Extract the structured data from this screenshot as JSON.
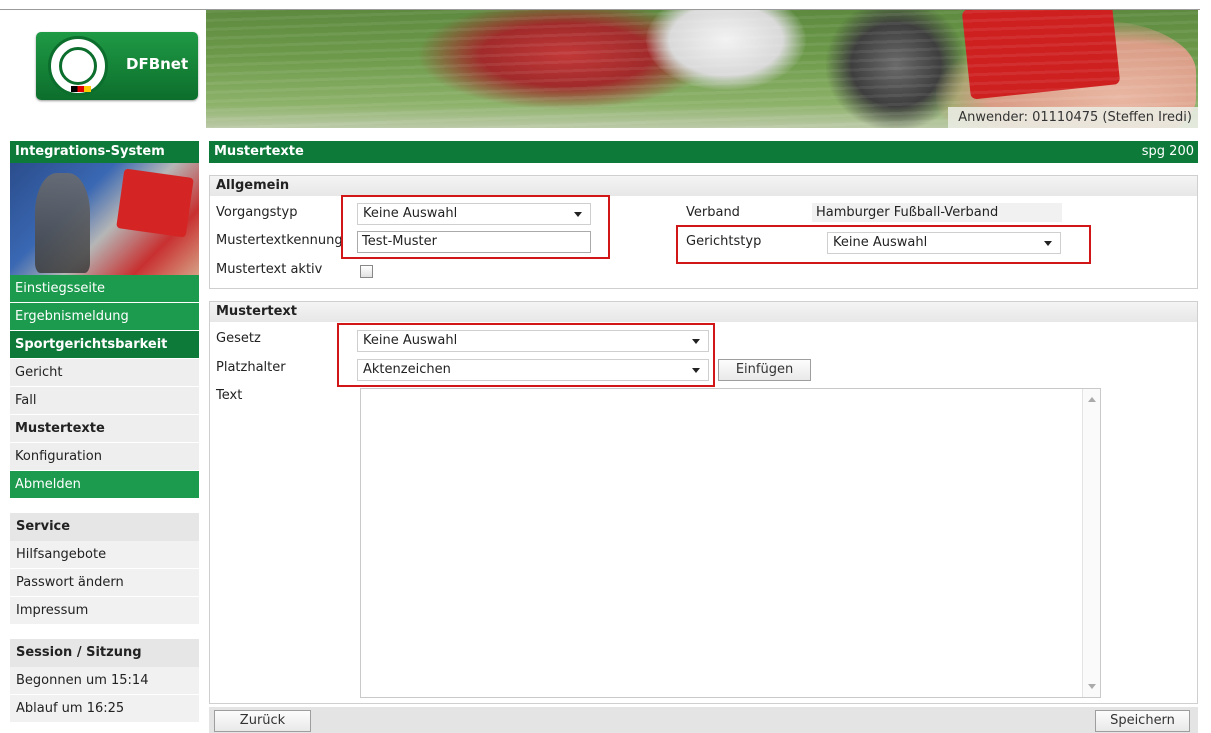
{
  "header": {
    "logo_text": "DFBnet",
    "user_info": "Anwender: 01110475 (Steffen Iredi)"
  },
  "sidebar": {
    "title": "Integrations-System",
    "items": [
      {
        "label": "Einstiegsseite",
        "style": "green"
      },
      {
        "label": "Ergebnismeldung",
        "style": "green"
      },
      {
        "label": "Sportgerichtsbarkeit",
        "style": "dark"
      },
      {
        "label": "Gericht",
        "style": "grey"
      },
      {
        "label": "Fall",
        "style": "grey"
      },
      {
        "label": "Mustertexte",
        "style": "bold"
      },
      {
        "label": "Konfiguration",
        "style": "grey"
      },
      {
        "label": "Abmelden",
        "style": "green"
      }
    ],
    "service": {
      "title": "Service",
      "items": [
        "Hilfsangebote",
        "Passwort ändern",
        "Impressum"
      ]
    },
    "session": {
      "title": "Session / Sitzung",
      "start": "Begonnen um 15:14",
      "end": "Ablauf um 16:25"
    }
  },
  "main": {
    "title": "Mustertexte",
    "code": "spg 200",
    "allgemein": {
      "title": "Allgemein",
      "vorgangstyp_label": "Vorgangstyp",
      "vorgangstyp_value": "Keine Auswahl",
      "kennung_label": "Mustertextkennung",
      "kennung_value": "Test-Muster",
      "aktiv_label": "Mustertext aktiv",
      "aktiv_checked": false,
      "verband_label": "Verband",
      "verband_value": "Hamburger Fußball-Verband",
      "gerichtstyp_label": "Gerichtstyp",
      "gerichtstyp_value": "Keine Auswahl"
    },
    "mustertext": {
      "title": "Mustertext",
      "gesetz_label": "Gesetz",
      "gesetz_value": "Keine Auswahl",
      "platzhalter_label": "Platzhalter",
      "platzhalter_value": "Aktenzeichen",
      "einfuegen_label": "Einfügen",
      "text_label": "Text",
      "text_value": ""
    },
    "buttons": {
      "back": "Zurück",
      "save": "Speichern"
    }
  },
  "colors": {
    "brand_green": "#0e7a3a",
    "nav_green": "#1c9a4d",
    "highlight_red": "#d01616"
  }
}
